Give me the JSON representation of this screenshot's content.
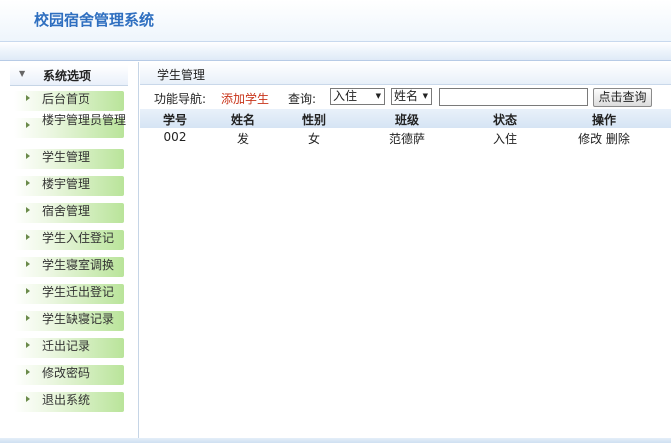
{
  "app": {
    "title": "校园宿舍管理系统"
  },
  "sidebar": {
    "header": "系统选项",
    "items": [
      {
        "label": "后台首页"
      },
      {
        "label": "楼宇管理员管理"
      },
      {
        "label": "学生管理"
      },
      {
        "label": "楼宇管理"
      },
      {
        "label": "宿舍管理"
      },
      {
        "label": "学生入住登记"
      },
      {
        "label": "学生寝室调换"
      },
      {
        "label": "学生迁出登记"
      },
      {
        "label": "学生缺寝记录"
      },
      {
        "label": "迁出记录"
      },
      {
        "label": "修改密码"
      },
      {
        "label": "退出系统"
      }
    ]
  },
  "main": {
    "breadcrumb": "学生管理",
    "func_nav_label": "功能导航:",
    "add_link": "添加学生",
    "query_label": "查询:",
    "status_select": {
      "value": "入住"
    },
    "field_select": {
      "value": "姓名"
    },
    "search_input": {
      "value": ""
    },
    "search_button": "点击查询",
    "table": {
      "columns": [
        "学号",
        "姓名",
        "性别",
        "班级",
        "状态",
        "操作"
      ],
      "rows": [
        {
          "id": "002",
          "name": "发",
          "gender": "女",
          "class": "范德萨",
          "status": "入住",
          "edit": "修改",
          "delete": "删除"
        }
      ]
    }
  },
  "colors": {
    "title_blue": "#2f6fc0",
    "link_red": "#c8341a",
    "nav_green": "#b9e49a"
  }
}
